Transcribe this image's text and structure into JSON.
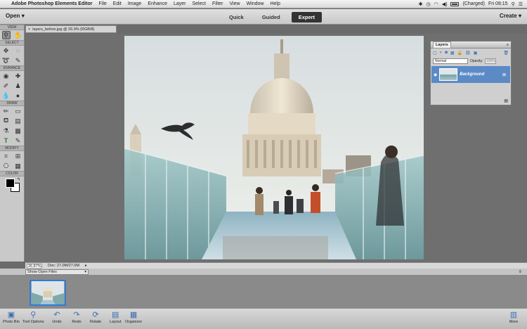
{
  "menubar": {
    "app_name": "Adobe Photoshop Elements Editor",
    "items": [
      "File",
      "Edit",
      "Image",
      "Enhance",
      "Layer",
      "Select",
      "Filter",
      "View",
      "Window",
      "Help"
    ],
    "battery_label": "(Charged)",
    "clock": "Fri 08:15"
  },
  "appbar": {
    "open_label": "Open",
    "create_label": "Create",
    "modes": [
      "Quick",
      "Guided",
      "Expert"
    ],
    "active_mode": "Expert"
  },
  "toolbox": {
    "sections": {
      "view": "VIEW",
      "select": "SELECT",
      "enhance": "ENHANCE",
      "draw": "DRAW",
      "modify": "MODIFY",
      "color": "COLOR"
    }
  },
  "document": {
    "tab_title": "layers_before.jpg @ 26.9% (RGB/8)",
    "zoom": "26.87%",
    "doc_size": "Doc: 27.0M/27.0M"
  },
  "layers_panel": {
    "title": "Layers",
    "blend_mode": "Normal",
    "opacity_label": "Opacity:",
    "opacity_value": "100%",
    "layer_name": "Background"
  },
  "photo_bin": {
    "dropdown": "Show Open Files"
  },
  "taskbar": {
    "photo_bin": "Photo Bin",
    "tool_options": "Tool Options",
    "undo": "Undo",
    "redo": "Redo",
    "rotate": "Rotate",
    "layout": "Layout",
    "organizer": "Organizer",
    "more": "More"
  },
  "colors": {
    "active_mode_bg": "#333333",
    "layer_selected": "#5b8ac6",
    "accent": "#2f7bd8"
  }
}
